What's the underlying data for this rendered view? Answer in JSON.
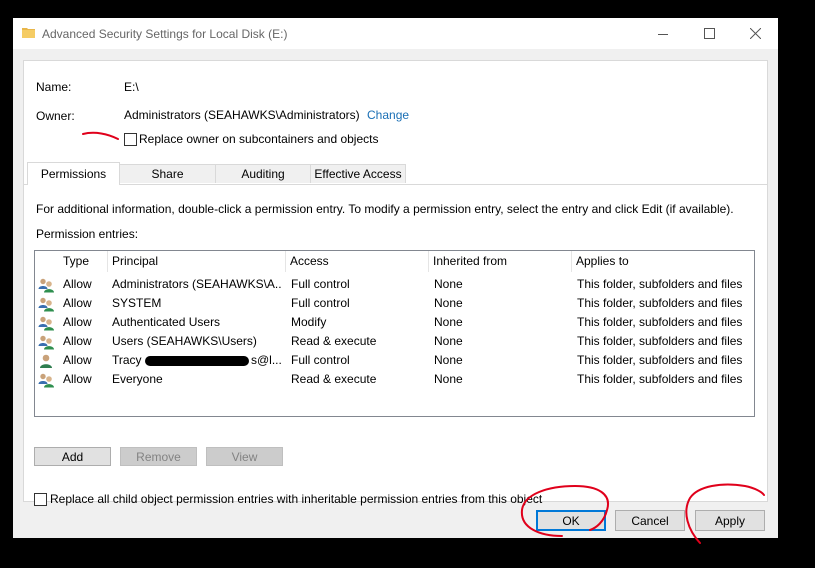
{
  "window": {
    "title": "Advanced Security Settings for Local Disk  (E:)",
    "icon": "folder-icon",
    "minimize_icon": "minimize-icon",
    "maximize_icon": "maximize-icon",
    "close_icon": "close-icon"
  },
  "info": {
    "name_label": "Name:",
    "name_value": "E:\\",
    "owner_label": "Owner:",
    "owner_value": "Administrators (SEAHAWKS\\Administrators)",
    "change_link": "Change",
    "replace_owner_label": "Replace owner on subcontainers and objects"
  },
  "tabs": [
    {
      "label": "Permissions",
      "active": true
    },
    {
      "label": "Share",
      "active": false
    },
    {
      "label": "Auditing",
      "active": false
    },
    {
      "label": "Effective Access",
      "active": false
    }
  ],
  "permissions": {
    "description": "For additional information, double-click a permission entry. To modify a permission entry, select the entry and click Edit (if available).",
    "entries_label": "Permission entries:",
    "columns": [
      "Type",
      "Principal",
      "Access",
      "Inherited from",
      "Applies to"
    ],
    "rows": [
      {
        "icon": "users-group-icon",
        "type": "Allow",
        "principal": "Administrators (SEAHAWKS\\A...",
        "access": "Full control",
        "inherited": "None",
        "applies": "This folder, subfolders and files"
      },
      {
        "icon": "users-group-icon",
        "type": "Allow",
        "principal": "SYSTEM",
        "access": "Full control",
        "inherited": "None",
        "applies": "This folder, subfolders and files"
      },
      {
        "icon": "users-group-icon",
        "type": "Allow",
        "principal": "Authenticated Users",
        "access": "Modify",
        "inherited": "None",
        "applies": "This folder, subfolders and files"
      },
      {
        "icon": "users-group-icon",
        "type": "Allow",
        "principal": "Users (SEAHAWKS\\Users)",
        "access": "Read & execute",
        "inherited": "None",
        "applies": "This folder, subfolders and files"
      },
      {
        "icon": "user-icon",
        "type": "Allow",
        "principal": "Tracy",
        "principal_tail": "s@l...",
        "access": "Full control",
        "inherited": "None",
        "applies": "This folder, subfolders and files"
      },
      {
        "icon": "users-group-icon",
        "type": "Allow",
        "principal": "Everyone",
        "access": "Read & execute",
        "inherited": "None",
        "applies": "This folder, subfolders and files"
      }
    ],
    "add_button": "Add",
    "remove_button": "Remove",
    "view_button": "View",
    "replace_child_label": "Replace all child object permission entries with inheritable permission entries from this object"
  },
  "footer": {
    "ok_button": "OK",
    "cancel_button": "Cancel",
    "apply_button": "Apply"
  },
  "colors": {
    "link": "#1a6fb5",
    "annotation": "#e0001b",
    "default_button_border": "#0078d7"
  }
}
